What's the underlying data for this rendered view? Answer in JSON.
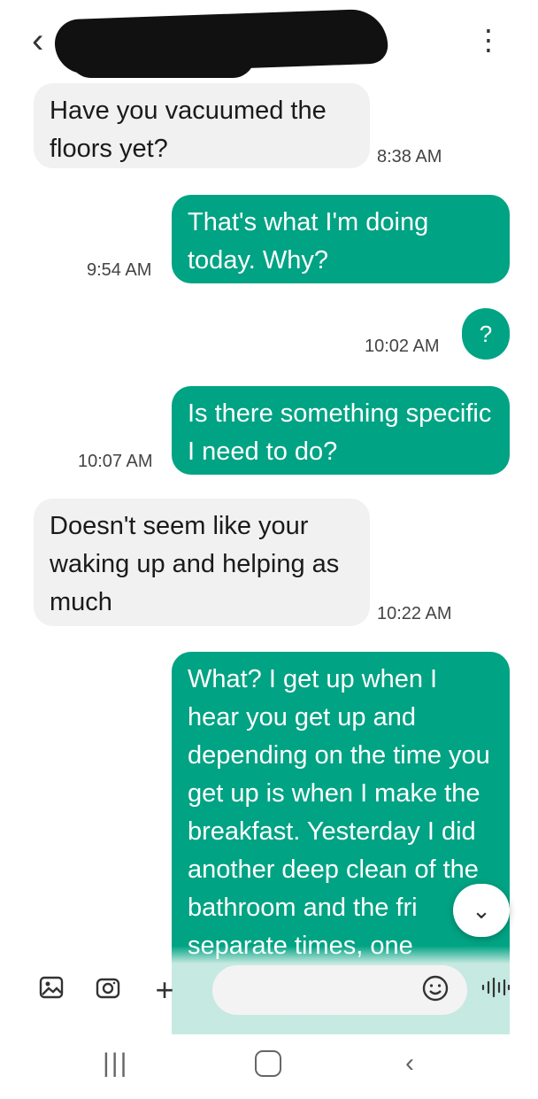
{
  "header": {
    "back_icon": "chevron-left-icon",
    "more_icon": "more-vertical-icon"
  },
  "messages": [
    {
      "direction": "incoming",
      "text": "Have you vacuumed the floors yet?",
      "time": "8:38 AM"
    },
    {
      "direction": "outgoing",
      "text": "That's what I'm doing today. Why?",
      "time": "9:54 AM"
    },
    {
      "direction": "outgoing",
      "text": "?",
      "time": "10:02 AM"
    },
    {
      "direction": "outgoing",
      "text": "Is there something specific I need to do?",
      "time": "10:07 AM"
    },
    {
      "direction": "incoming",
      "text": "Doesn't seem like your waking up and helping as much",
      "time": "10:22 AM"
    },
    {
      "direction": "outgoing",
      "text": "What? I get up when I hear you get up and depending on the time you get up is when I make the breakfast. Yesterday I did another deep clean of the bathroom and the fri separate times, one"
    }
  ],
  "input_bar": {
    "gallery_icon": "image-icon",
    "camera_icon": "camera-icon",
    "plus_icon": "plus-icon",
    "emoji_icon": "emoji-icon",
    "voice_icon": "voice-wave-icon"
  },
  "colors": {
    "outgoing": "#00a383",
    "incoming": "#f1f1f1"
  }
}
